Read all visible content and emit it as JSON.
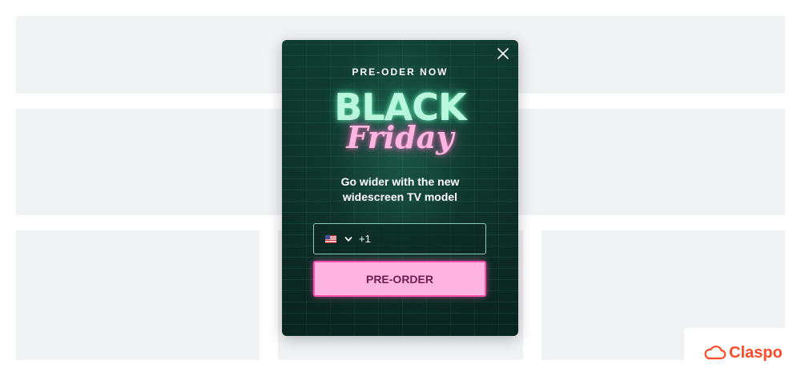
{
  "popup": {
    "pre_title": "PRE-ODER NOW",
    "headline_top": "BLACK",
    "headline_bottom": "Friday",
    "subtitle_line1": "Go wider with the new",
    "subtitle_line2_plain": "widescreen ",
    "subtitle_line2_bold": "TV model",
    "phone_code": "+1",
    "country_flag": "US",
    "cta_label": "PRE-ORDER",
    "close_icon": "close-icon"
  },
  "brand": {
    "name": "Claspo",
    "logo_icon": "cloud-icon",
    "color": "#ff4a2a"
  },
  "colors": {
    "popup_bg": "#0f3a30",
    "neon_green": "#b9f7df",
    "neon_pink": "#ffb7e2",
    "cta_bg": "#ffb3e0",
    "cta_border": "#ff4fae",
    "cta_text": "#6b1f4f",
    "placeholder": "#f1f2f4"
  }
}
